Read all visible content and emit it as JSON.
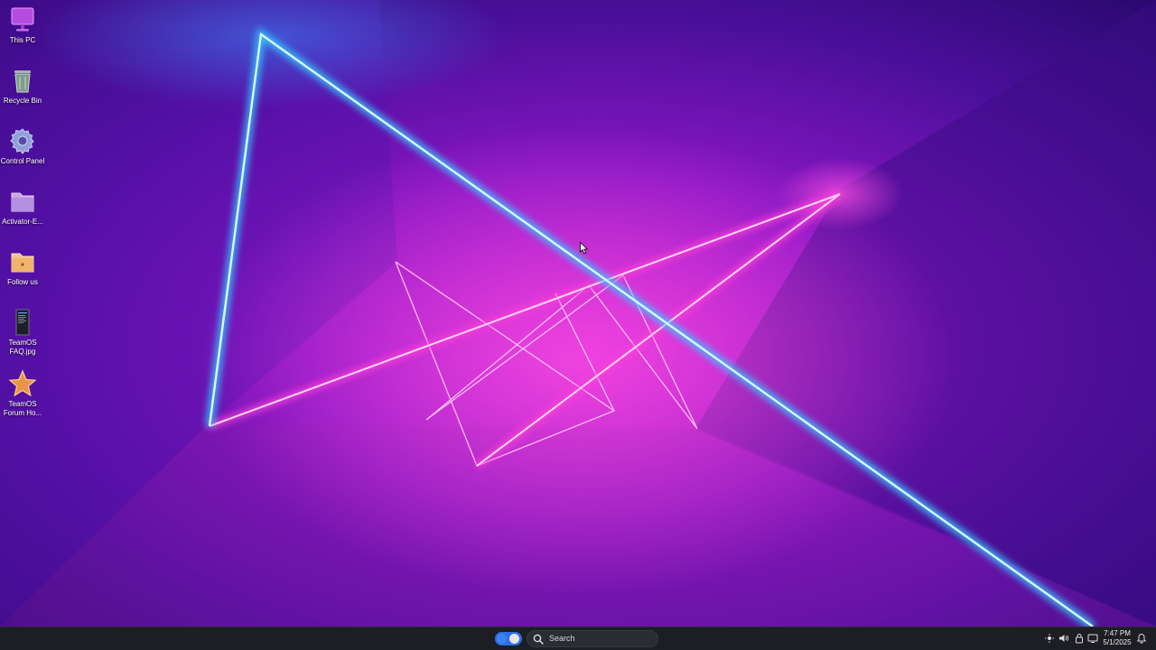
{
  "desktop": {
    "icons": [
      {
        "label": "This PC",
        "icon": "monitor-icon"
      },
      {
        "label": "Recycle Bin",
        "icon": "recycle-bin-icon"
      },
      {
        "label": "Control Panel",
        "icon": "gear-icon"
      },
      {
        "label": "Activator-E...",
        "icon": "folder-icon"
      },
      {
        "label": "Follow us",
        "icon": "folder-icon"
      },
      {
        "label": "TeamOS FAQ.jpg",
        "icon": "image-file-icon"
      },
      {
        "label": "TeamOS Forum Ho...",
        "icon": "star-icon"
      }
    ]
  },
  "taskbar": {
    "search_placeholder": "Search",
    "clock_time": "7:47 PM",
    "clock_date": "5/1/2025"
  },
  "colors": {
    "taskbar_bg": "#1d1d24",
    "accent": "#2f6fe6",
    "neon_cyan": "#5fe3ff",
    "neon_magenta": "#ff3fd8"
  }
}
